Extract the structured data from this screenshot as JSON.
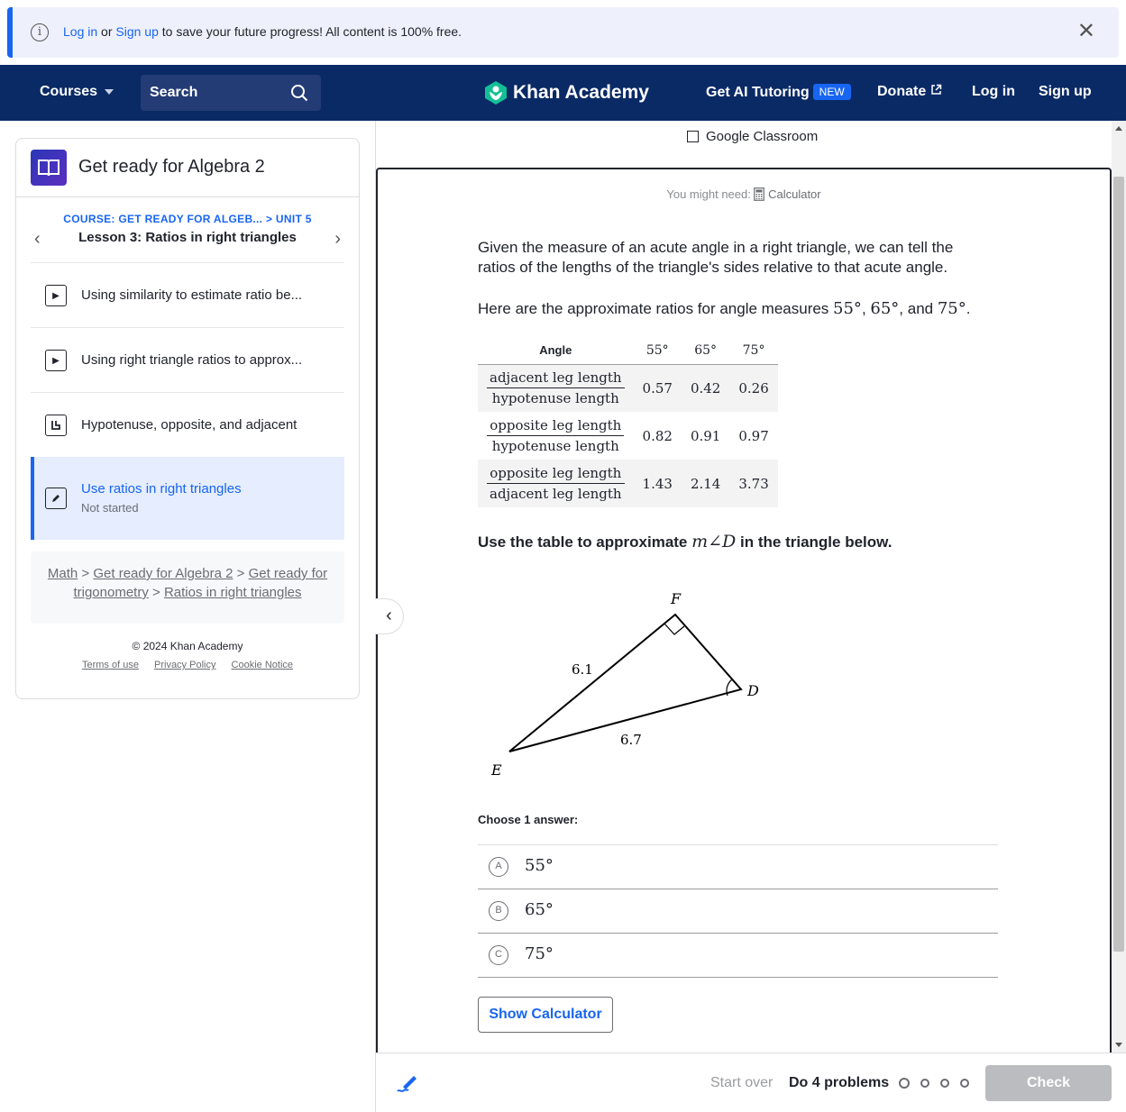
{
  "banner": {
    "login_link": "Log in",
    "or_text": " or ",
    "signup_link": "Sign up",
    "message": " to save your future progress! All content is 100% free."
  },
  "nav": {
    "courses": "Courses",
    "search_label": "Search",
    "logo_text": "Khan Academy",
    "ai_tutoring": "Get AI Tutoring",
    "new_badge": "NEW",
    "donate": "Donate",
    "login": "Log in",
    "signup": "Sign up"
  },
  "sidebar": {
    "course_title": "Get ready for Algebra 2",
    "course_crumb": "COURSE: GET READY FOR ALGEB...",
    "unit_crumb": "> UNIT 5",
    "lesson_title": "Lesson 3: Ratios in right triangles",
    "items": [
      {
        "label": "Using similarity to estimate ratio be...",
        "type": "video"
      },
      {
        "label": "Using right triangle ratios to approx...",
        "type": "video"
      },
      {
        "label": "Hypotenuse, opposite, and adjacent",
        "type": "exercise"
      },
      {
        "label": "Use ratios in right triangles",
        "sub": "Not started",
        "type": "practice"
      }
    ],
    "breadcrumb": {
      "math": "Math",
      "algebra2": "Get ready for Algebra 2",
      "trig": "Get ready for trigonometry",
      "ratios": "Ratios in right triangles"
    },
    "copyright": "© 2024 Khan Academy",
    "links": {
      "terms": "Terms of use",
      "privacy": "Privacy Policy",
      "cookie": "Cookie Notice"
    }
  },
  "content": {
    "google_classroom": "Google Classroom",
    "might_need": "You might need: ",
    "calculator": "Calculator",
    "intro": "Given the measure of an acute angle in a right triangle, we can tell the ratios of the lengths of the triangle's sides relative to that acute angle.",
    "ratios_intro_pre": "Here are the approximate ratios for angle measures ",
    "ratios_angles": [
      "55°",
      "65°",
      "75°"
    ],
    "ratios_and": ", and ",
    "table": {
      "header": [
        "Angle",
        "55°",
        "65°",
        "75°"
      ],
      "rows": [
        {
          "num": "adjacent leg length",
          "den": "hypotenuse length",
          "values": [
            "0.57",
            "0.42",
            "0.26"
          ]
        },
        {
          "num": "opposite leg length",
          "den": "hypotenuse length",
          "values": [
            "0.82",
            "0.91",
            "0.97"
          ]
        },
        {
          "num": "opposite leg length",
          "den": "adjacent leg length",
          "values": [
            "1.43",
            "2.14",
            "3.73"
          ]
        }
      ]
    },
    "task_pre": "Use the table to approximate ",
    "task_math": "m∠D",
    "task_post": " in the triangle below.",
    "diagram": {
      "F": "F",
      "D": "D",
      "E": "E",
      "side_EF": "6.1",
      "side_ED": "6.7"
    },
    "choose": "Choose 1 answer:",
    "choices": [
      {
        "letter": "A",
        "value": "55°"
      },
      {
        "letter": "B",
        "value": "65°"
      },
      {
        "letter": "C",
        "value": "75°"
      }
    ],
    "show_calculator": "Show Calculator"
  },
  "bottom": {
    "start_over": "Start over",
    "do_problems": "Do 4 problems",
    "check": "Check",
    "progress_done": 0,
    "progress_total": 4
  },
  "colors": {
    "brand_blue": "#1865f2",
    "nav_bg": "#0a2a66",
    "logo_green": "#14bf96"
  }
}
